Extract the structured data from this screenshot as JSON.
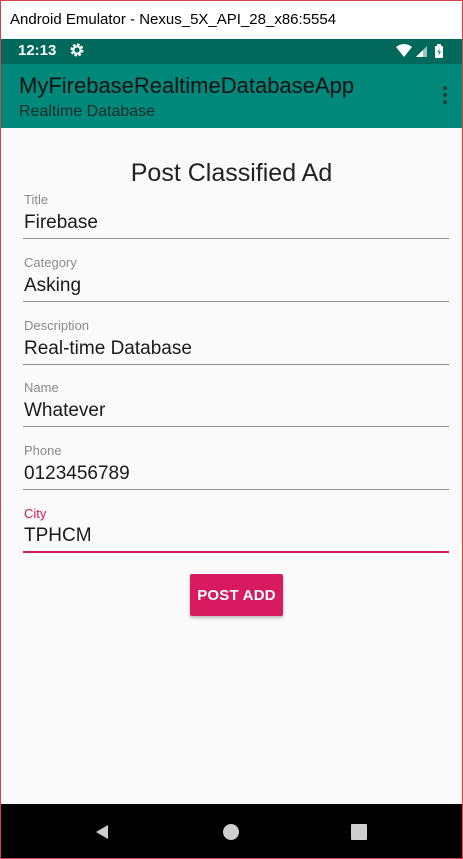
{
  "window": {
    "title": "Android Emulator - Nexus_5X_API_28_x86:5554"
  },
  "status_bar": {
    "time": "12:13",
    "icons": [
      "settings-gear-icon",
      "wifi-icon",
      "cell-signal-icon",
      "battery-icon"
    ]
  },
  "app_bar": {
    "title": "MyFirebaseRealtimeDatabaseApp",
    "subtitle": "Realtime Database",
    "menu_icon": "overflow-menu-icon"
  },
  "form": {
    "heading": "Post Classified Ad",
    "fields": [
      {
        "label": "Title",
        "value": "Firebase",
        "focused": false
      },
      {
        "label": "Category",
        "value": "Asking",
        "focused": false
      },
      {
        "label": "Description",
        "value": "Real-time Database",
        "focused": false
      },
      {
        "label": "Name",
        "value": "Whatever",
        "focused": false
      },
      {
        "label": "Phone",
        "value": "0123456789",
        "focused": false
      },
      {
        "label": "City",
        "value": "TPHCM",
        "focused": true
      }
    ],
    "submit_label": "POST ADD"
  },
  "navigation_bar": {
    "buttons": [
      "back-icon",
      "home-icon",
      "recents-icon"
    ]
  },
  "colors": {
    "status_bar": "#00695c",
    "app_bar": "#00897b",
    "accent": "#d81b60",
    "background": "#fafafa"
  }
}
